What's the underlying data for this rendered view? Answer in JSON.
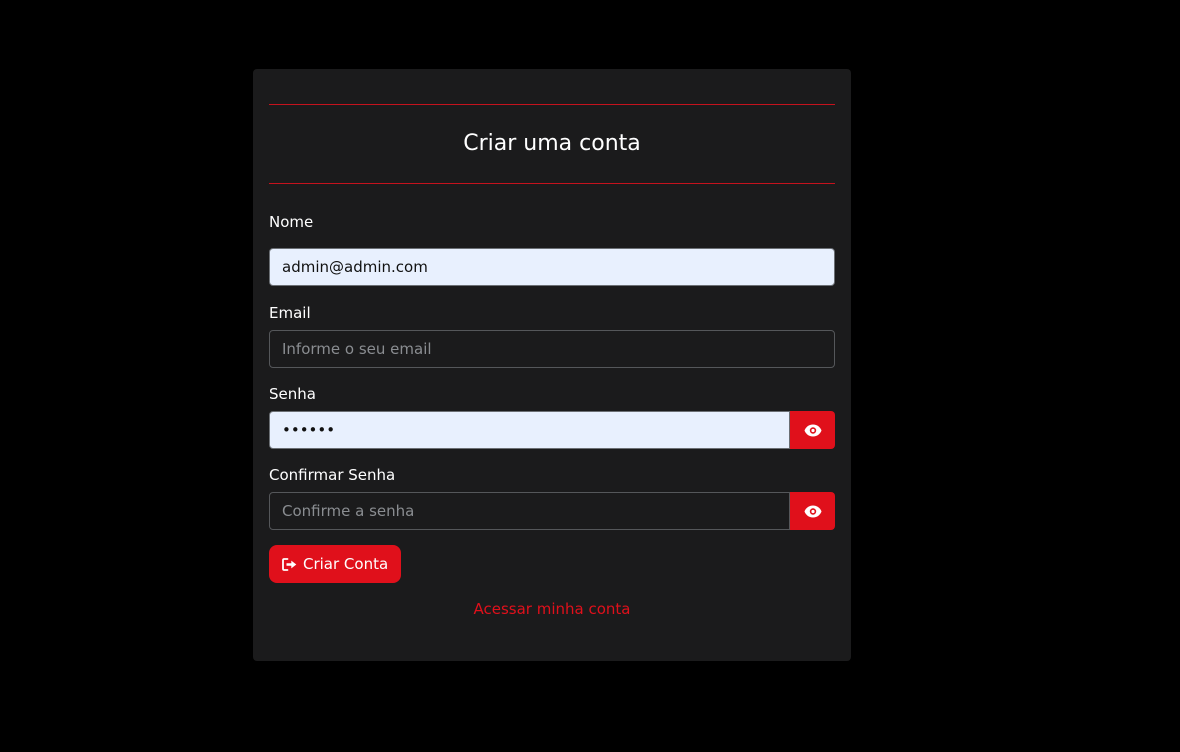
{
  "form": {
    "title": "Criar uma conta",
    "fields": {
      "nome": {
        "label": "Nome",
        "value": "admin@admin.com",
        "placeholder": ""
      },
      "email": {
        "label": "Email",
        "value": "",
        "placeholder": "Informe o seu email"
      },
      "senha": {
        "label": "Senha",
        "value": "••••••",
        "placeholder": ""
      },
      "confirmar": {
        "label": "Confirmar Senha",
        "value": "",
        "placeholder": "Confirme a senha"
      }
    },
    "submit_label": "Criar Conta",
    "login_link": "Acessar minha conta"
  },
  "icons": {
    "password_toggle": "eye-icon",
    "submit": "sign-in-icon"
  },
  "colors": {
    "accent": "#e0101b",
    "card_bg": "#1b1b1c",
    "page_bg": "#000000",
    "autofill_bg": "#e8f0fe"
  }
}
